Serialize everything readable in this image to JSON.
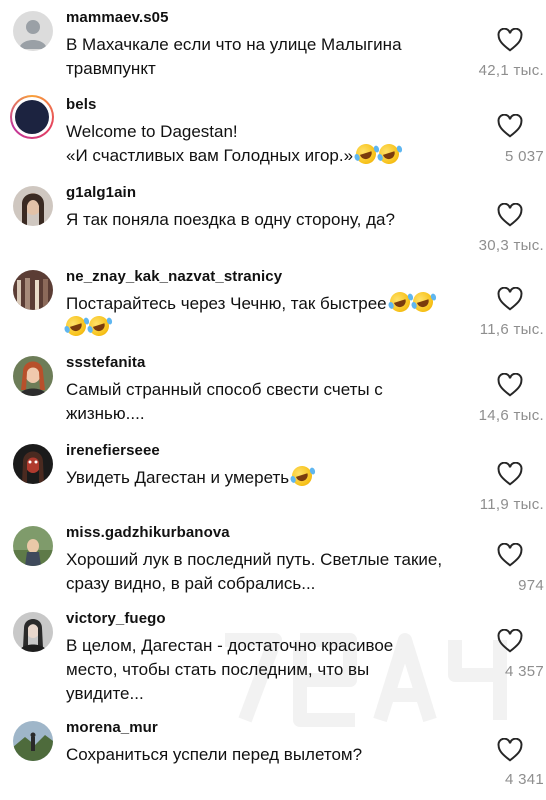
{
  "comments": [
    {
      "username": "mammaev.s05",
      "text": "В Махачкале если что на улице Малыгина\nтравмпункт",
      "emoji_count": 0,
      "likes": "42,1 тыс."
    },
    {
      "username": "bels",
      "text": "Welcome to Dagestan!\n«И счастливых вам Голодных игор.»",
      "emoji_count": 2,
      "likes": "5 037"
    },
    {
      "username": "g1alg1ain",
      "text": "Я так поняла поездка в одну сторону, да?",
      "emoji_count": 0,
      "likes": "30,3 тыс."
    },
    {
      "username": "ne_znay_kak_nazvat_stranicy",
      "text": "Постарайтесь через Чечню, так быстрее",
      "emoji_count": 4,
      "likes": "11,6 тыс."
    },
    {
      "username": "ssstefanita",
      "text": "Самый странный способ свести счеты с\nжизнью....",
      "emoji_count": 0,
      "likes": "14,6 тыс."
    },
    {
      "username": "irenefierseee",
      "text": "Увидеть Дагестан и умереть",
      "emoji_count": 1,
      "likes": "11,9 тыс."
    },
    {
      "username": "miss.gadzhikurbanova",
      "text": "Хороший лук в последний путь. Светлые такие,\nсразу видно, в рай собрались...",
      "emoji_count": 0,
      "likes": "974"
    },
    {
      "username": "victory_fuego",
      "text": "В целом, Дагестан - достаточно красивое\nместо, чтобы стать последним, что вы\nувидите...",
      "emoji_count": 0,
      "likes": "4 357"
    },
    {
      "username": "morena_mur",
      "text": "Сохраниться успели перед вылетом?",
      "emoji_count": 0,
      "likes": "4 341"
    }
  ],
  "icons": {
    "like": "heart-outline-icon",
    "emoji": "rofl-emoji-icon"
  },
  "colors": {
    "text": "#111111",
    "secondary": "#8e8e8e",
    "background": "#ffffff"
  }
}
